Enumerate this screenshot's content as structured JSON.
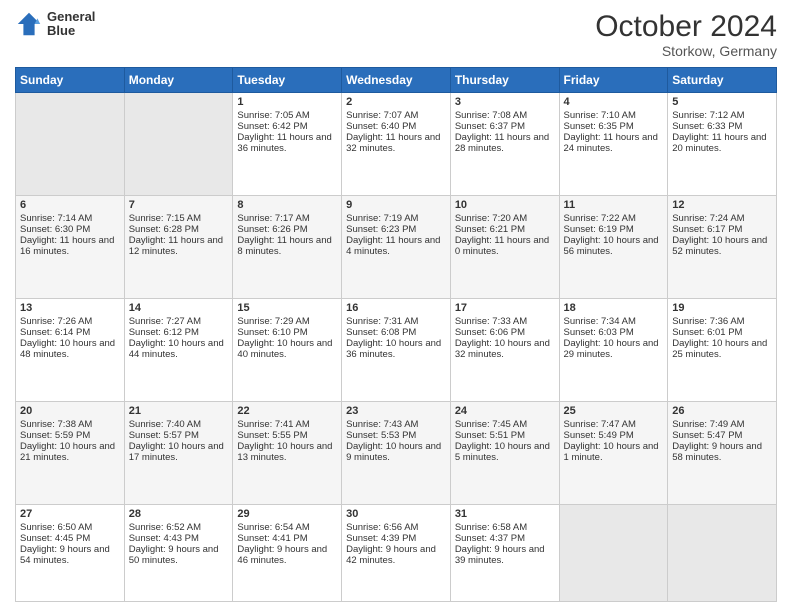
{
  "header": {
    "logo": {
      "line1": "General",
      "line2": "Blue"
    },
    "title": "October 2024",
    "subtitle": "Storkow, Germany"
  },
  "calendar": {
    "days_of_week": [
      "Sunday",
      "Monday",
      "Tuesday",
      "Wednesday",
      "Thursday",
      "Friday",
      "Saturday"
    ],
    "weeks": [
      [
        {
          "day": "",
          "content": ""
        },
        {
          "day": "",
          "content": ""
        },
        {
          "day": "1",
          "content": "Sunrise: 7:05 AM\nSunset: 6:42 PM\nDaylight: 11 hours and 36 minutes."
        },
        {
          "day": "2",
          "content": "Sunrise: 7:07 AM\nSunset: 6:40 PM\nDaylight: 11 hours and 32 minutes."
        },
        {
          "day": "3",
          "content": "Sunrise: 7:08 AM\nSunset: 6:37 PM\nDaylight: 11 hours and 28 minutes."
        },
        {
          "day": "4",
          "content": "Sunrise: 7:10 AM\nSunset: 6:35 PM\nDaylight: 11 hours and 24 minutes."
        },
        {
          "day": "5",
          "content": "Sunrise: 7:12 AM\nSunset: 6:33 PM\nDaylight: 11 hours and 20 minutes."
        }
      ],
      [
        {
          "day": "6",
          "content": "Sunrise: 7:14 AM\nSunset: 6:30 PM\nDaylight: 11 hours and 16 minutes."
        },
        {
          "day": "7",
          "content": "Sunrise: 7:15 AM\nSunset: 6:28 PM\nDaylight: 11 hours and 12 minutes."
        },
        {
          "day": "8",
          "content": "Sunrise: 7:17 AM\nSunset: 6:26 PM\nDaylight: 11 hours and 8 minutes."
        },
        {
          "day": "9",
          "content": "Sunrise: 7:19 AM\nSunset: 6:23 PM\nDaylight: 11 hours and 4 minutes."
        },
        {
          "day": "10",
          "content": "Sunrise: 7:20 AM\nSunset: 6:21 PM\nDaylight: 11 hours and 0 minutes."
        },
        {
          "day": "11",
          "content": "Sunrise: 7:22 AM\nSunset: 6:19 PM\nDaylight: 10 hours and 56 minutes."
        },
        {
          "day": "12",
          "content": "Sunrise: 7:24 AM\nSunset: 6:17 PM\nDaylight: 10 hours and 52 minutes."
        }
      ],
      [
        {
          "day": "13",
          "content": "Sunrise: 7:26 AM\nSunset: 6:14 PM\nDaylight: 10 hours and 48 minutes."
        },
        {
          "day": "14",
          "content": "Sunrise: 7:27 AM\nSunset: 6:12 PM\nDaylight: 10 hours and 44 minutes."
        },
        {
          "day": "15",
          "content": "Sunrise: 7:29 AM\nSunset: 6:10 PM\nDaylight: 10 hours and 40 minutes."
        },
        {
          "day": "16",
          "content": "Sunrise: 7:31 AM\nSunset: 6:08 PM\nDaylight: 10 hours and 36 minutes."
        },
        {
          "day": "17",
          "content": "Sunrise: 7:33 AM\nSunset: 6:06 PM\nDaylight: 10 hours and 32 minutes."
        },
        {
          "day": "18",
          "content": "Sunrise: 7:34 AM\nSunset: 6:03 PM\nDaylight: 10 hours and 29 minutes."
        },
        {
          "day": "19",
          "content": "Sunrise: 7:36 AM\nSunset: 6:01 PM\nDaylight: 10 hours and 25 minutes."
        }
      ],
      [
        {
          "day": "20",
          "content": "Sunrise: 7:38 AM\nSunset: 5:59 PM\nDaylight: 10 hours and 21 minutes."
        },
        {
          "day": "21",
          "content": "Sunrise: 7:40 AM\nSunset: 5:57 PM\nDaylight: 10 hours and 17 minutes."
        },
        {
          "day": "22",
          "content": "Sunrise: 7:41 AM\nSunset: 5:55 PM\nDaylight: 10 hours and 13 minutes."
        },
        {
          "day": "23",
          "content": "Sunrise: 7:43 AM\nSunset: 5:53 PM\nDaylight: 10 hours and 9 minutes."
        },
        {
          "day": "24",
          "content": "Sunrise: 7:45 AM\nSunset: 5:51 PM\nDaylight: 10 hours and 5 minutes."
        },
        {
          "day": "25",
          "content": "Sunrise: 7:47 AM\nSunset: 5:49 PM\nDaylight: 10 hours and 1 minute."
        },
        {
          "day": "26",
          "content": "Sunrise: 7:49 AM\nSunset: 5:47 PM\nDaylight: 9 hours and 58 minutes."
        }
      ],
      [
        {
          "day": "27",
          "content": "Sunrise: 6:50 AM\nSunset: 4:45 PM\nDaylight: 9 hours and 54 minutes."
        },
        {
          "day": "28",
          "content": "Sunrise: 6:52 AM\nSunset: 4:43 PM\nDaylight: 9 hours and 50 minutes."
        },
        {
          "day": "29",
          "content": "Sunrise: 6:54 AM\nSunset: 4:41 PM\nDaylight: 9 hours and 46 minutes."
        },
        {
          "day": "30",
          "content": "Sunrise: 6:56 AM\nSunset: 4:39 PM\nDaylight: 9 hours and 42 minutes."
        },
        {
          "day": "31",
          "content": "Sunrise: 6:58 AM\nSunset: 4:37 PM\nDaylight: 9 hours and 39 minutes."
        },
        {
          "day": "",
          "content": ""
        },
        {
          "day": "",
          "content": ""
        }
      ]
    ]
  }
}
